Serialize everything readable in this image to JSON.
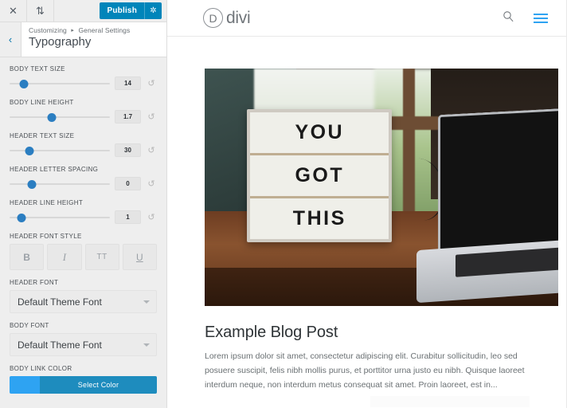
{
  "customizer": {
    "toolbar": {
      "close_icon": "close-icon",
      "close_glyph": "✕",
      "collapse_icon": "expand-collapse-icon",
      "collapse_glyph": "⇅",
      "publish_label": "Publish",
      "gear_glyph": "✲",
      "publish_color": "#0085ba"
    },
    "back_glyph": "‹",
    "breadcrumb": {
      "root": "Customizing",
      "separator": "▸",
      "section": "General Settings"
    },
    "panel_title": "Typography",
    "controls": [
      {
        "type": "slider",
        "label": "BODY TEXT SIZE",
        "value": "14",
        "knob_percent": 14,
        "reset_glyph": "↺"
      },
      {
        "type": "slider",
        "label": "BODY LINE HEIGHT",
        "value": "1.7",
        "knob_percent": 42,
        "reset_glyph": "↺"
      },
      {
        "type": "slider",
        "label": "HEADER TEXT SIZE",
        "value": "30",
        "knob_percent": 20,
        "reset_glyph": "↺"
      },
      {
        "type": "slider",
        "label": "HEADER LETTER SPACING",
        "value": "0",
        "knob_percent": 22,
        "reset_glyph": "↺"
      },
      {
        "type": "slider",
        "label": "HEADER LINE HEIGHT",
        "value": "1",
        "knob_percent": 12,
        "reset_glyph": "↺"
      }
    ],
    "font_style": {
      "label": "HEADER FONT STYLE",
      "buttons": [
        {
          "name": "bold",
          "glyph": "B"
        },
        {
          "name": "italic",
          "glyph": "I"
        },
        {
          "name": "uppercase",
          "glyph": "TT"
        },
        {
          "name": "underline",
          "glyph": "U"
        }
      ]
    },
    "header_font": {
      "label": "HEADER FONT",
      "value": "Default Theme Font"
    },
    "body_font": {
      "label": "BODY FONT",
      "value": "Default Theme Font"
    },
    "body_link_color": {
      "label": "BODY LINK COLOR",
      "button_label": "Select Color",
      "swatch_color": "#2ea3f2",
      "button_color": "#1e8cbe"
    }
  },
  "preview": {
    "site_header": {
      "logo_letter": "D",
      "logo_text": "divi",
      "search_icon": "search-icon",
      "search_glyph": "⌕",
      "menu_icon": "hamburger-menu-icon",
      "accent_color": "#2ea3f2"
    },
    "featured_image": {
      "alt": "Lightbox sign reading YOU GOT THIS beside a laptop on a wooden desk",
      "sign_lines": [
        "YOU",
        "GOT",
        "THIS"
      ]
    },
    "post": {
      "title": "Example Blog Post",
      "excerpt": "Lorem ipsum dolor sit amet, consectetur adipiscing elit. Curabitur sollicitudin, leo sed posuere suscipit, felis nibh mollis purus, et porttitor urna justo eu nibh. Quisque laoreet interdum neque, non interdum metus consequat sit amet. Proin laoreet, est in..."
    }
  }
}
